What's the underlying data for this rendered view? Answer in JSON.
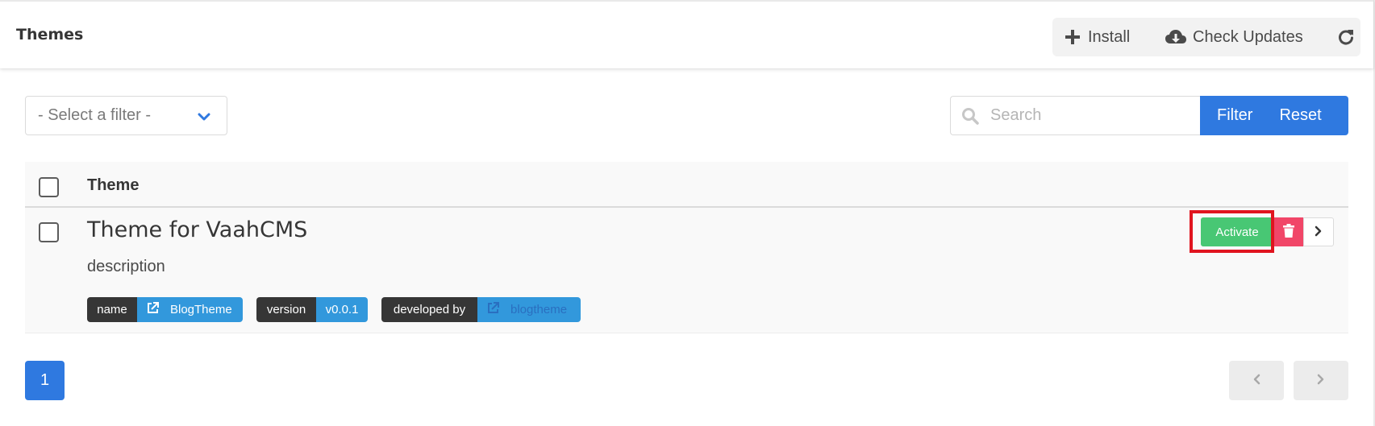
{
  "header": {
    "title": "Themes",
    "install_label": "Install",
    "check_updates_label": "Check Updates"
  },
  "filters": {
    "select_placeholder": "- Select a filter -",
    "search_placeholder": "Search",
    "filter_label": "Filter",
    "reset_label": "Reset"
  },
  "table": {
    "column_theme": "Theme",
    "rows": [
      {
        "title": "Theme for VaahCMS",
        "description": "description",
        "tags": [
          {
            "key": "name",
            "value": "BlogTheme",
            "icon": "external-link-icon"
          },
          {
            "key": "version",
            "value": "v0.0.1"
          },
          {
            "key": "developed by",
            "value": "blogtheme",
            "icon": "external-link-icon"
          }
        ],
        "activate_label": "Activate"
      }
    ]
  },
  "pagination": {
    "current_page": "1"
  },
  "colors": {
    "primary": "#2f79e0",
    "success": "#48c774",
    "danger": "#f14668",
    "tag_dark": "#363636",
    "tag_info": "#3298dc",
    "highlight": "#e0141f"
  }
}
